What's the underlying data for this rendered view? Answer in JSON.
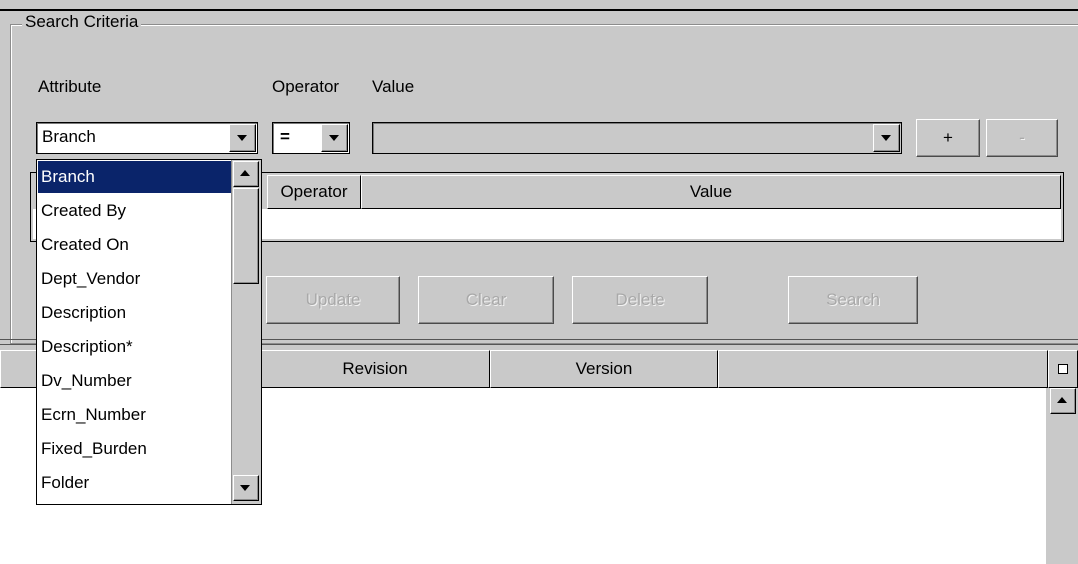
{
  "search_criteria": {
    "legend": "Search Criteria",
    "labels": {
      "attribute": "Attribute",
      "operator": "Operator",
      "value": "Value"
    },
    "attribute_value": "Branch",
    "operator_value": "=",
    "value_field": "",
    "add_button": "+",
    "remove_button": "-",
    "criteria_table": {
      "columns": [
        "Operator",
        "Value"
      ]
    },
    "buttons": {
      "update": "Update",
      "clear": "Clear",
      "delete": "Delete",
      "search": "Search"
    }
  },
  "attribute_dropdown": {
    "selected": "Branch",
    "options": [
      "Branch",
      "Created By",
      "Created On",
      "Dept_Vendor",
      "Description",
      "Description*",
      "Dv_Number",
      "Ecrn_Number",
      "Fixed_Burden",
      "Folder"
    ]
  },
  "results_table": {
    "columns": [
      "Revision",
      "Version"
    ]
  },
  "colors": {
    "background": "#c9c9c9",
    "selection": "#0a246a",
    "disabled_text": "#a9a9a9"
  }
}
